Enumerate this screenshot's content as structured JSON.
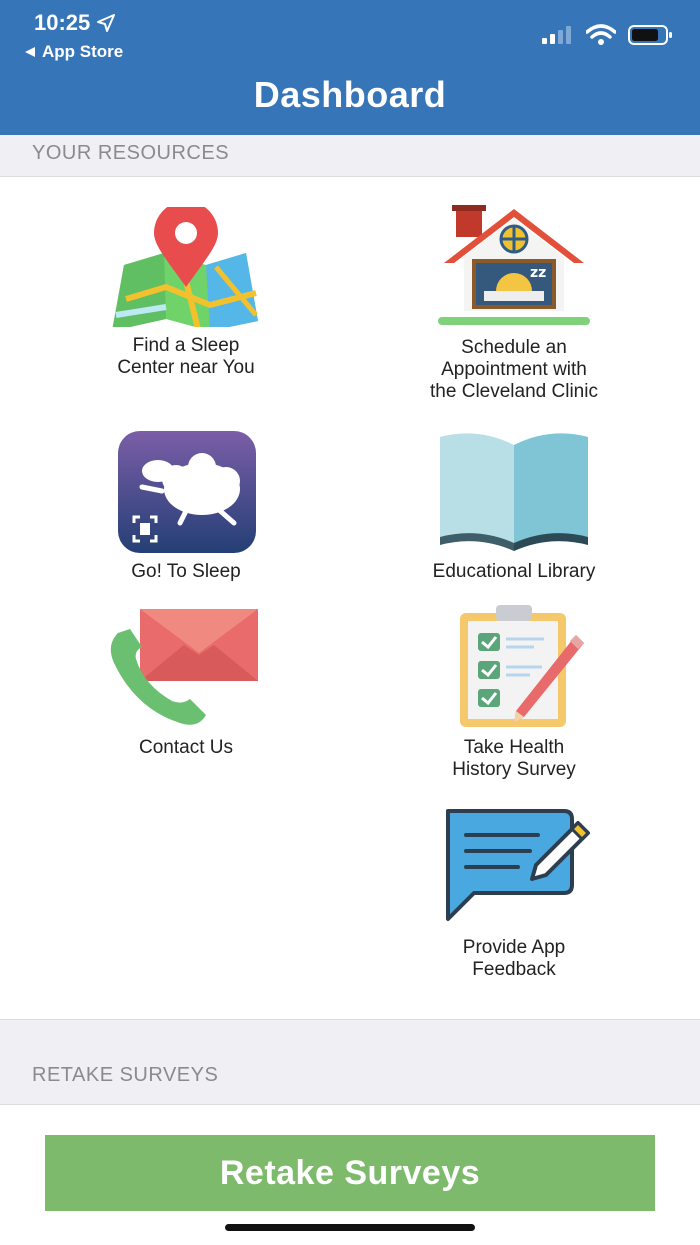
{
  "status_bar": {
    "time": "10:25",
    "back_label": "App Store"
  },
  "nav": {
    "title": "Dashboard"
  },
  "resources": {
    "header": "YOUR RESOURCES",
    "items": [
      {
        "label": "Find a Sleep\nCenter near You",
        "icon": "map-pin-icon"
      },
      {
        "label": "Schedule an\nAppointment with\nthe Cleveland Clinic",
        "icon": "house-sleep-icon"
      },
      {
        "label": "Go! To Sleep",
        "icon": "sheep-app-icon"
      },
      {
        "label": "Educational Library",
        "icon": "open-book-icon"
      },
      {
        "label": "Contact Us",
        "icon": "phone-mail-icon"
      },
      {
        "label": "Take Health\nHistory Survey",
        "icon": "clipboard-checklist-icon"
      },
      {
        "label": "Provide App\nFeedback",
        "icon": "feedback-bubble-icon"
      }
    ]
  },
  "surveys": {
    "header": "RETAKE SURVEYS",
    "button_label": "Retake Surveys"
  },
  "colors": {
    "nav_bar": "#3675b8",
    "retake_button": "#7dba6b",
    "section_header_text": "#8a8a8f"
  }
}
